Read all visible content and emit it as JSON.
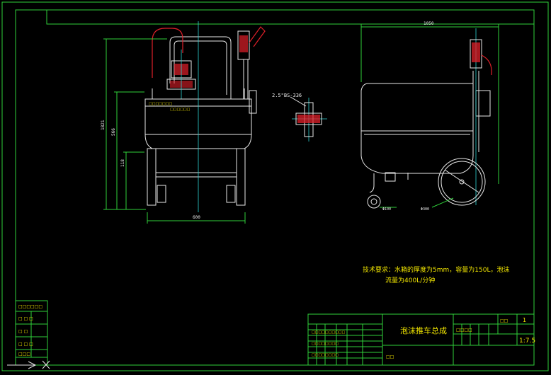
{
  "title_block": {
    "drawing_title": "泡沫推车总成",
    "scale": "1:7.5",
    "sheet": "1"
  },
  "annotations": {
    "pipe_label": "2.5\"BS-336",
    "tech_req_line1": "技术要求：水箱的厚度为5mm，容量为150L，泡沫",
    "tech_req_line2": "流量为400L/分钟"
  },
  "dimensions": {
    "front_height": "1821",
    "front_mid": "566",
    "front_low": "118",
    "front_width": "600",
    "side_width": "1050",
    "side_wheel_small": "Φ100",
    "side_wheel_large": "Φ300"
  },
  "colors": {
    "frame": "#2fd13a",
    "outline": "#e8e8e8",
    "valves": "#e0202a",
    "text": "#f2e600"
  }
}
